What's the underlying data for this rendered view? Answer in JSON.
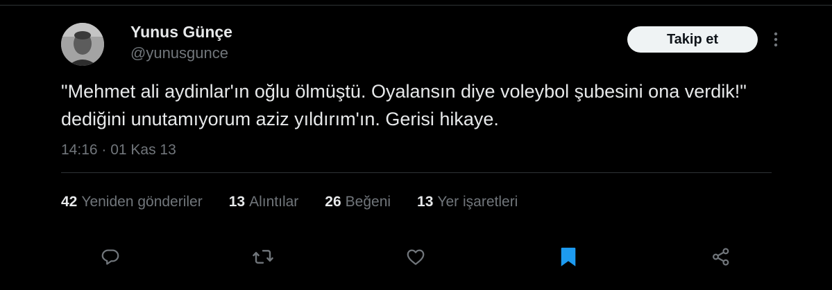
{
  "author": {
    "name": "Yunus Günçe",
    "handle": "@yunusgunce"
  },
  "follow_button_label": "Takip et",
  "tweet": {
    "text": "\"Mehmet ali aydinlar'ın oğlu ölmüştü. Oyalansın diye voleybol şubesini ona verdik!\" dediğini unutamıyorum aziz yıldırım'ın. Gerisi hikaye.",
    "time": "14:16 · 01 Kas 13"
  },
  "stats": [
    {
      "count": "42",
      "label": "Yeniden gönderiler"
    },
    {
      "count": "13",
      "label": "Alıntılar"
    },
    {
      "count": "26",
      "label": "Beğeni"
    },
    {
      "count": "13",
      "label": "Yer işaretleri"
    }
  ],
  "actions": [
    {
      "icon": "reply-icon"
    },
    {
      "icon": "retweet-icon"
    },
    {
      "icon": "like-icon"
    },
    {
      "icon": "bookmark-icon",
      "active": true
    },
    {
      "icon": "share-icon"
    }
  ],
  "colors": {
    "background": "#000000",
    "text_primary": "#e7e9ea",
    "text_secondary": "#71767b",
    "divider": "#2f3336",
    "bookmark_active": "#1d9bf0"
  }
}
